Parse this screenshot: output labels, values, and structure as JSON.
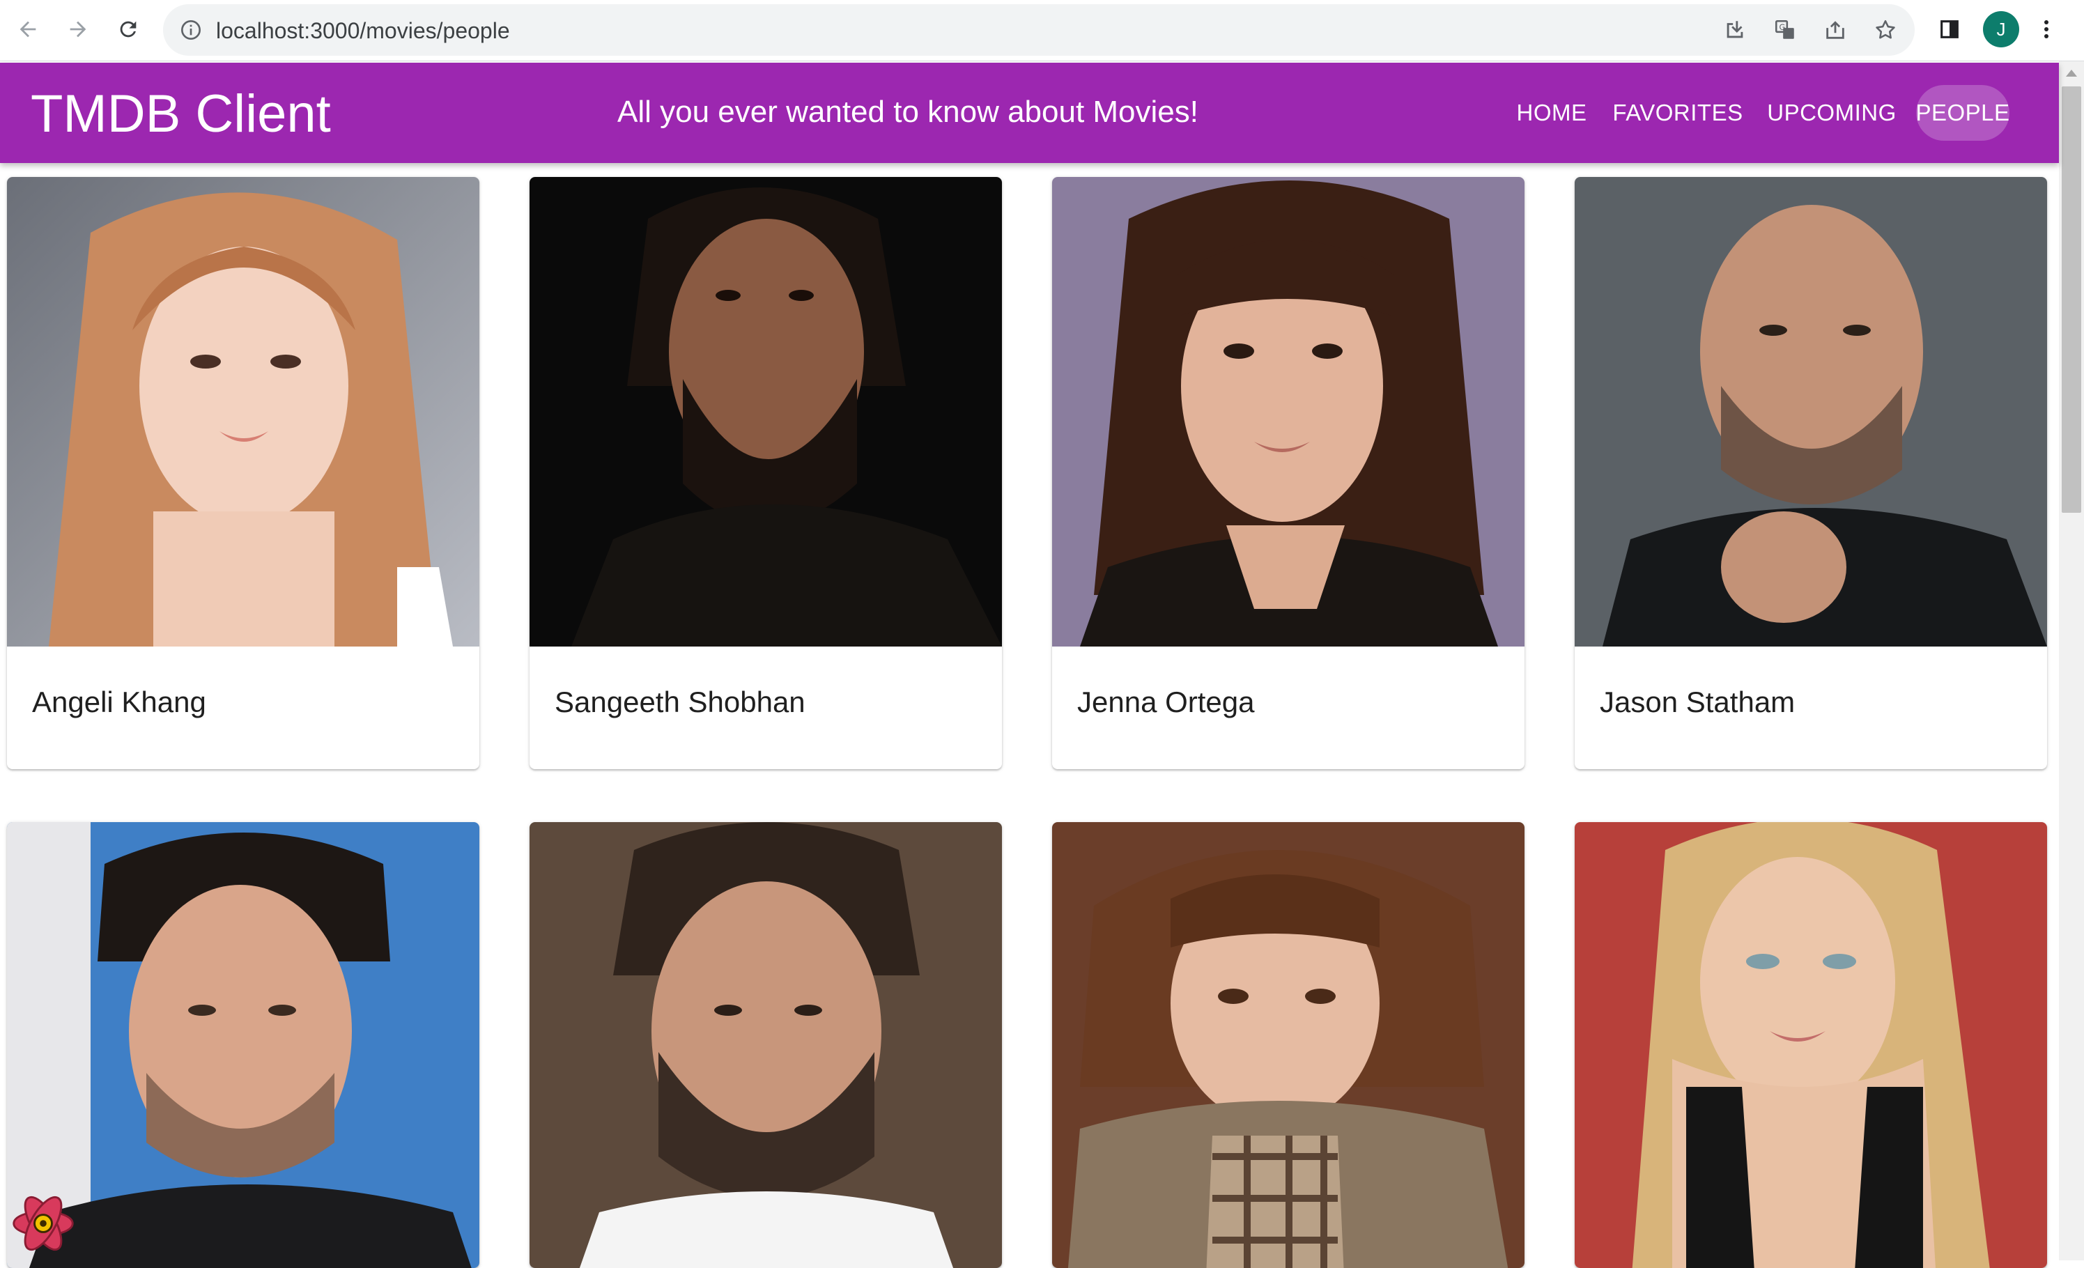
{
  "browser": {
    "url": "localhost:3000/movies/people",
    "profile_initial": "J"
  },
  "header": {
    "title": "TMDB Client",
    "tagline": "All you ever wanted to know about Movies!",
    "nav": [
      {
        "label": "HOME",
        "active": false
      },
      {
        "label": "FAVORITES",
        "active": false
      },
      {
        "label": "UPCOMING",
        "active": false
      },
      {
        "label": "PEOPLE",
        "active": true
      }
    ]
  },
  "people": [
    {
      "name": "Angeli Khang"
    },
    {
      "name": "Sangeeth Shobhan"
    },
    {
      "name": "Jenna Ortega"
    },
    {
      "name": "Jason Statham"
    },
    {
      "name": ""
    },
    {
      "name": ""
    },
    {
      "name": ""
    },
    {
      "name": ""
    }
  ],
  "colors": {
    "accent": "#9c27b0",
    "omnibox": "#f1f3f4"
  }
}
